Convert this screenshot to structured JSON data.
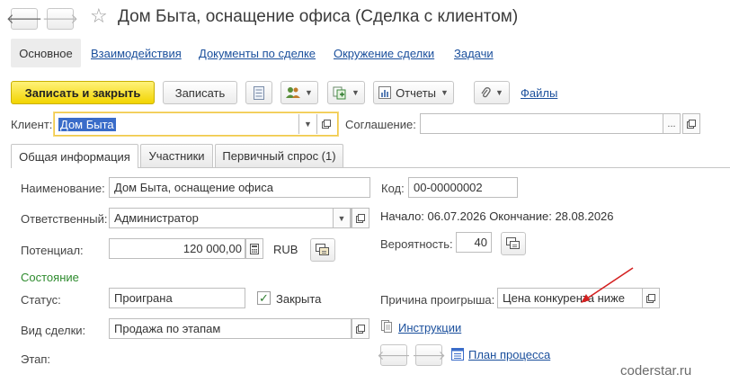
{
  "window": {
    "title": "Дом Быта, оснащение офиса (Сделка с клиентом)",
    "back_glyph": "🡐",
    "forward_glyph": "🡒"
  },
  "nav": {
    "active": "Основное",
    "links": [
      "Взаимодействия",
      "Документы по сделке",
      "Окружение сделки",
      "Задачи"
    ]
  },
  "toolbar": {
    "save_close": "Записать и закрыть",
    "save": "Записать",
    "reports": "Отчеты",
    "files": "Файлы"
  },
  "client": {
    "label": "Клиент:",
    "value": "Дом Быта"
  },
  "agreement": {
    "label": "Соглашение:",
    "value": "",
    "ellipsis": "..."
  },
  "tabs": [
    "Общая информация",
    "Участники",
    "Первичный спрос (1)"
  ],
  "form": {
    "name_label": "Наименование:",
    "name_value": "Дом Быта, оснащение офиса",
    "code_label": "Код:",
    "code_value": "00-00000002",
    "responsible_label": "Ответственный:",
    "responsible_value": "Администратор",
    "dates_text": "Начало: 06.07.2026 Окончание: 28.08.2026",
    "potential_label": "Потенциал:",
    "potential_value": "120 000,00",
    "currency": "RUB",
    "probability_label": "Вероятность:",
    "probability_value": "40",
    "state_header": "Состояние",
    "status_label": "Статус:",
    "status_value": "Проиграна",
    "closed_label": "Закрыта",
    "closed_checked": true,
    "loss_reason_label": "Причина проигрыша:",
    "loss_reason_value": "Цена конкурента ниже",
    "deal_type_label": "Вид сделки:",
    "deal_type_value": "Продажа по этапам",
    "instructions_link": "Инструкции",
    "stage_label": "Этап:",
    "process_plan_link": "План процесса"
  },
  "watermark": "coderstar.ru",
  "colors": {
    "primary_button": "#f2d400",
    "link": "#1a4f9c",
    "state_header": "#2e8b2e",
    "arrow": "#d42020"
  }
}
